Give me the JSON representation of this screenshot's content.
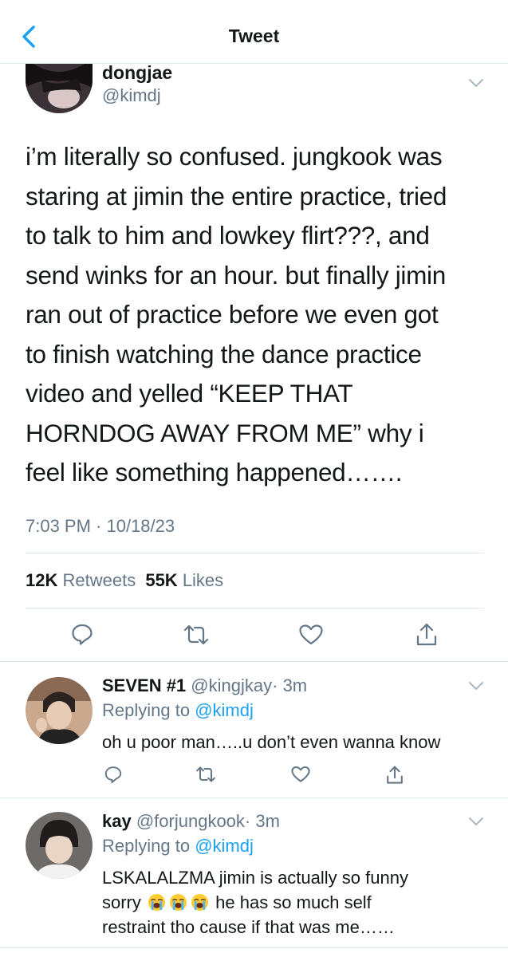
{
  "nav": {
    "title": "Tweet"
  },
  "tweet": {
    "author_name": "dongjae",
    "author_handle": "@kimdj",
    "text_lines": [
      "i’m literally so confused. jungkook was",
      "staring at jimin the entire practice, tried",
      "to talk to him and lowkey flirt???, and",
      "send winks for an hour. but finally jimin",
      "ran out of practice before we even got",
      "to finish watching the dance practice",
      "video and yelled “KEEP THAT",
      "HORNDOG AWAY FROM ME” why i",
      "feel like something happened……."
    ],
    "timestamp": "7:03 PM · 10/18/23",
    "retweets_count": "12K",
    "retweets_label": "Retweets",
    "likes_count": "55K",
    "likes_label": "Likes"
  },
  "replies": [
    {
      "name": "SEVEN #1",
      "handle": "@kingjkay",
      "time": "· 3m",
      "replying_prefix": "Replying to",
      "replying_to": "@kimdj",
      "text": "oh u poor man…..u don’t even wanna know"
    },
    {
      "name": "kay",
      "handle": "@forjungkook",
      "time": "· 3m",
      "replying_prefix": "Replying to",
      "replying_to": "@kimdj",
      "line1": "LSKALALZMA jimin is actually so funny",
      "line2a": "sorry",
      "line2b": "he has so much self",
      "line3": "restraint tho cause if that was me……"
    }
  ],
  "icons": {
    "back": "chevron-left-icon",
    "more": "chevron-down-icon",
    "reply": "reply-icon",
    "retweet": "retweet-icon",
    "like": "heart-icon",
    "share": "share-icon",
    "emoji": "loudly-crying-face-emoji"
  },
  "colors": {
    "accent": "#1da1f2",
    "secondary_text": "#657786",
    "divider": "#e1e8ed"
  }
}
